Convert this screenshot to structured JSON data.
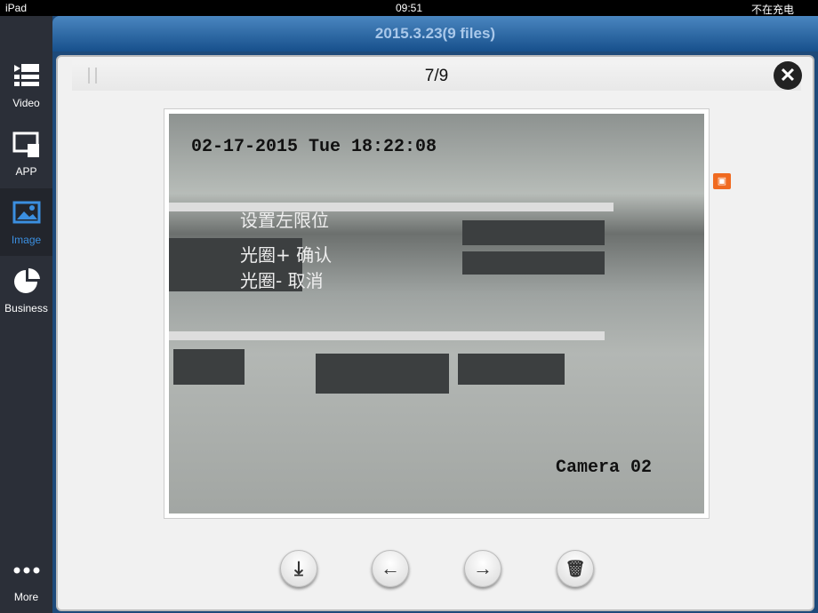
{
  "status": {
    "device": "iPad",
    "time": "09:51",
    "charging": "不在充电"
  },
  "sidebar": {
    "items": [
      {
        "label": "Video",
        "icon": "video-list-icon"
      },
      {
        "label": "APP",
        "icon": "app-icon"
      },
      {
        "label": "Image",
        "icon": "image-icon",
        "active": true
      },
      {
        "label": "Business",
        "icon": "pie-chart-icon"
      },
      {
        "label": "More",
        "icon": "more-icon"
      }
    ]
  },
  "header": {
    "title": "2015.3.23(9 files)"
  },
  "viewer": {
    "counter": "7/9",
    "close": "✕",
    "overlay": {
      "timestamp": "02-17-2015 Tue 18:22:08",
      "camera": "Camera 02",
      "menu": [
        "设置左限位",
        "光圈+ 确认",
        "光圈- 取消"
      ]
    },
    "buttons": {
      "download": "⤓",
      "prev": "←",
      "next": "→",
      "delete": "🗑"
    }
  },
  "colors": {
    "accent": "#3b8fe0",
    "header": "#1e5a96",
    "badge": "#f06a20"
  }
}
